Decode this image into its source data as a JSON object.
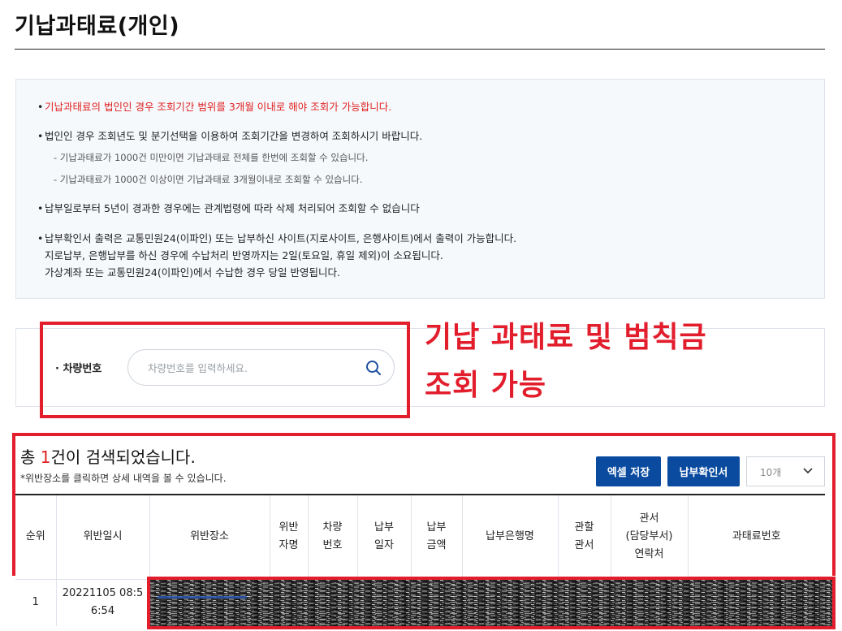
{
  "page": {
    "title": "기납과태료(개인)"
  },
  "notices": [
    {
      "text": "기납과태료의 법인인 경우 조회기간 범위를 3개월 이내로 해야 조회가 가능합니다."
    },
    {
      "text": "법인인 경우 조회년도 및 분기선택을 이용하여 조회기간을 변경하여 조회하시기 바랍니다."
    },
    {
      "text": "- 기납과태료가 1000건 미만이면 기납과태료 전체를 한번에 조회할 수 있습니다."
    },
    {
      "text": "- 기납과태료가 1000건 이상이면 기납과태료 3개월이내로 조회할 수 있습니다."
    },
    {
      "text": "납부일로부터 5년이 경과한 경우에는 관계법령에 따라 삭제 처리되어 조회할 수 없습니다"
    },
    {
      "text": "납부확인서 출력은 교통민원24(이파인) 또는 납부하신 사이트(지로사이트, 은행사이트)에서 출력이 가능합니다."
    },
    {
      "text": "지로납부, 은행납부를 하신 경우에 수납처리 반영까지는 2일(토요일, 휴일 제외)이 소요됩니다."
    },
    {
      "text": "가상계좌 또는 교통민원24(이파인)에서 수납한 경우 당일 반영됩니다."
    }
  ],
  "search": {
    "label": "차량번호",
    "placeholder": "차량번호를 입력하세요.",
    "icon": "search-icon"
  },
  "annotation": {
    "line1": "기납 과태료 및 범칙금",
    "line2": "조회 가능",
    "color": "#e21d2c"
  },
  "results": {
    "prefix": "총 ",
    "count": "1",
    "suffix": "건이 검색되었습니다.",
    "hint": "*위반장소를 클릭하면 상세 내역을 볼 수 있습니다.",
    "excel_button": "엑셀 저장",
    "confirm_button": "납부확인서",
    "page_size": "10개"
  },
  "table": {
    "columns": [
      "순위",
      "위반일시",
      "위반장소",
      "위반\n자명",
      "차량\n번호",
      "납부\n일자",
      "납부\n금액",
      "납부은행명",
      "관할\n관서",
      "관서\n(담당부서)\n연락처",
      "과태료번호"
    ],
    "rows": [
      {
        "rank": "1",
        "datetime": "20221105 08:5\n6:54"
      }
    ]
  },
  "colors": {
    "accent": "#0a4b9f",
    "alert": "#e02020",
    "highlight": "#e21d2c"
  }
}
